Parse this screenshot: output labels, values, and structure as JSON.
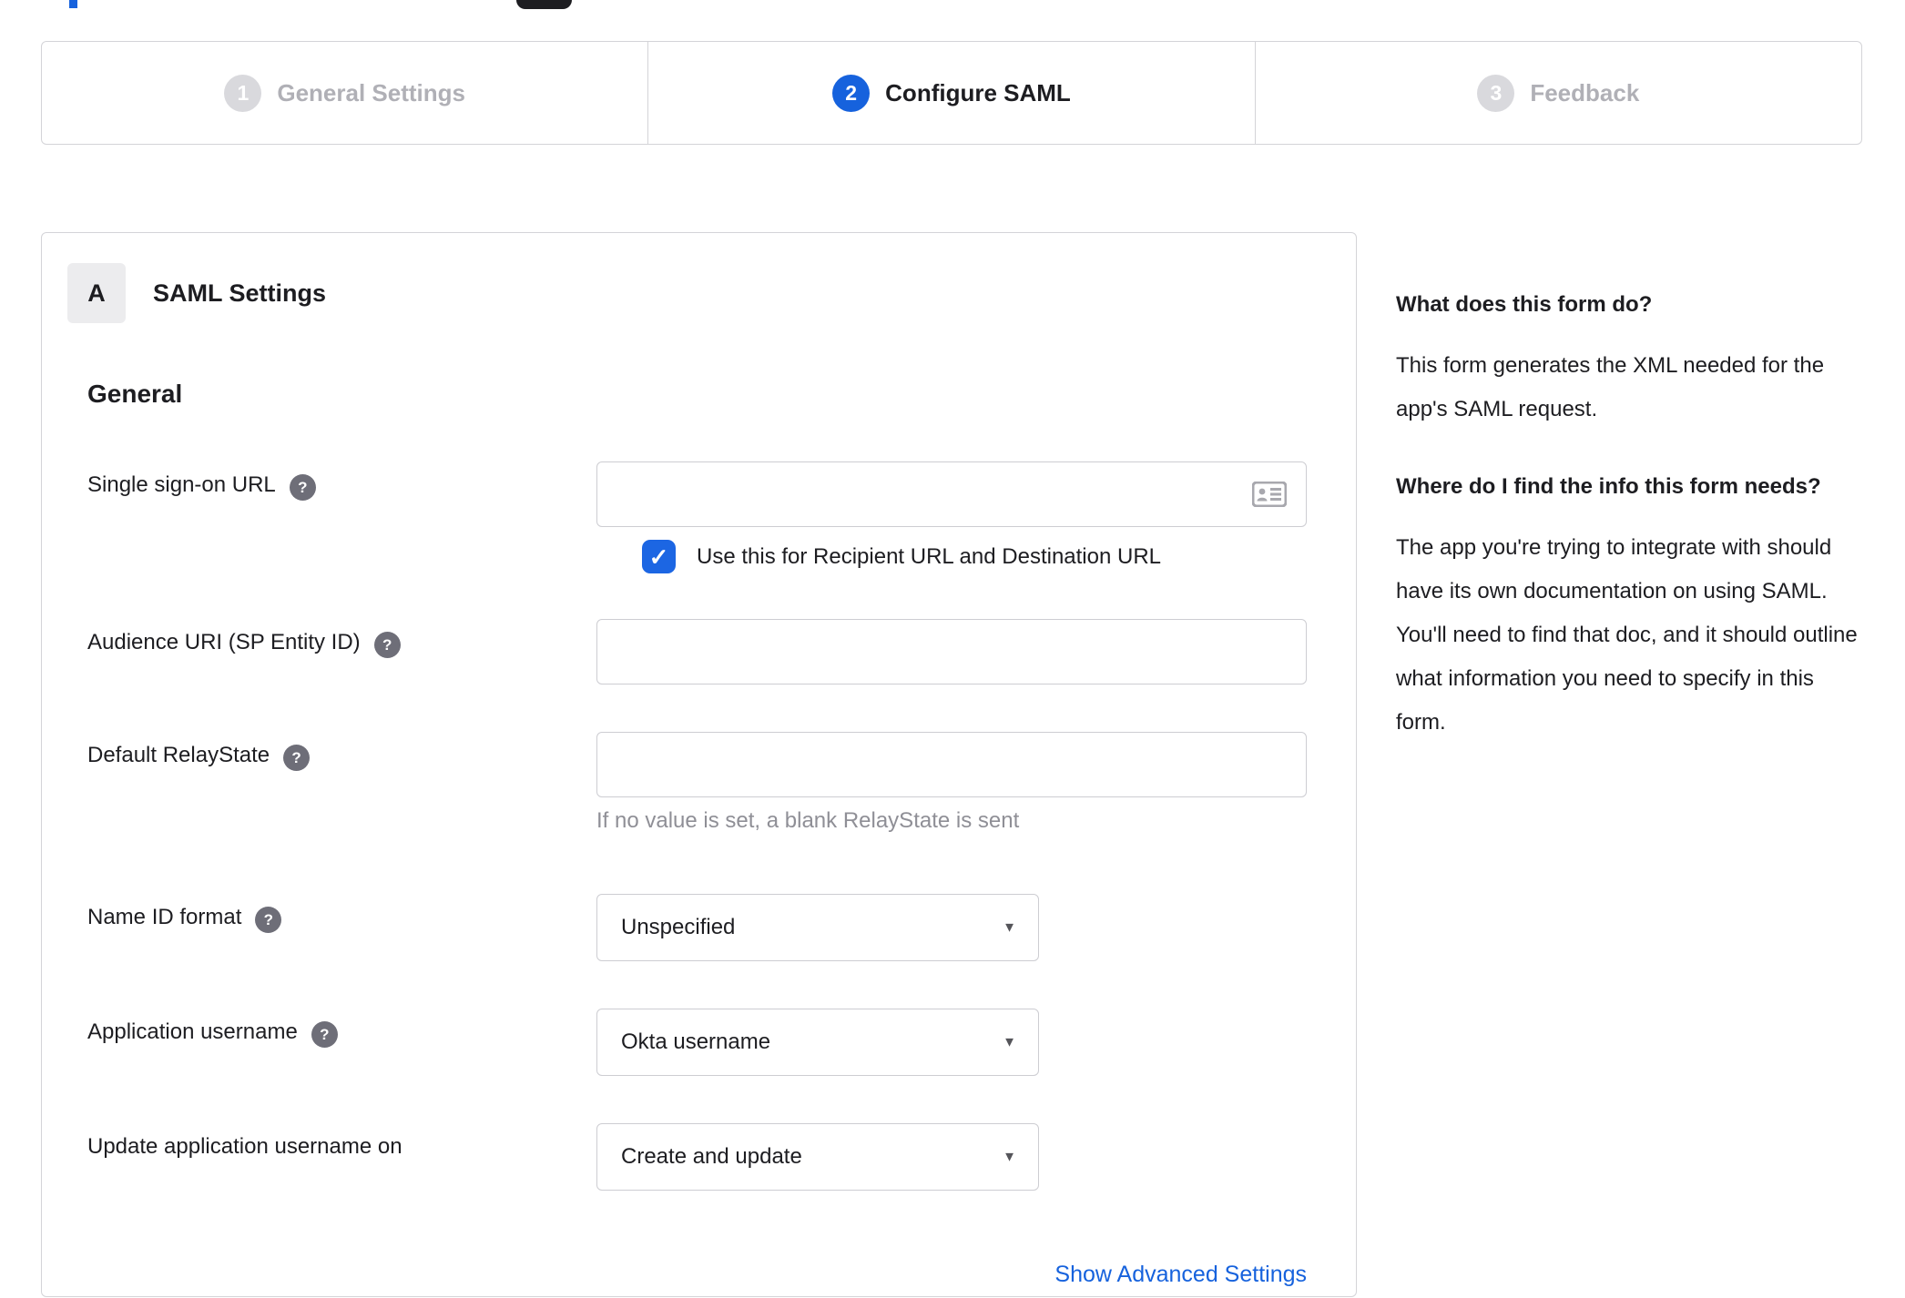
{
  "stepper": {
    "steps": [
      {
        "number": "1",
        "label": "General Settings"
      },
      {
        "number": "2",
        "label": "Configure SAML"
      },
      {
        "number": "3",
        "label": "Feedback"
      }
    ],
    "active_index": 1
  },
  "panel": {
    "badge": "A",
    "title": "SAML Settings",
    "section": "General",
    "fields": {
      "sso": {
        "label": "Single sign-on URL",
        "value": "",
        "checkbox_label": "Use this for Recipient URL and Destination URL",
        "checkbox_checked": true
      },
      "audience": {
        "label": "Audience URI (SP Entity ID)",
        "value": ""
      },
      "relay": {
        "label": "Default RelayState",
        "value": "",
        "hint": "If no value is set, a blank RelayState is sent"
      },
      "name_id_format": {
        "label": "Name ID format",
        "value": "Unspecified"
      },
      "app_username": {
        "label": "Application username",
        "value": "Okta username"
      },
      "update_username": {
        "label": "Update application username on",
        "value": "Create and update"
      }
    },
    "advanced_link": "Show Advanced Settings"
  },
  "sidebar": {
    "q1": "What does this form do?",
    "a1": "This form generates the XML needed for the app's SAML request.",
    "q2": "Where do I find the info this form needs?",
    "a2": "The app you're trying to integrate with should have its own documentation on using SAML. You'll need to find that doc, and it should outline what information you need to specify in this form."
  },
  "icons": {
    "help": "?",
    "check": "✓",
    "dropdown_arrow": "▼"
  },
  "colors": {
    "accent_blue": "#1662dd",
    "inactive_gray": "#d9d9dd",
    "border": "#d4d4d8"
  }
}
